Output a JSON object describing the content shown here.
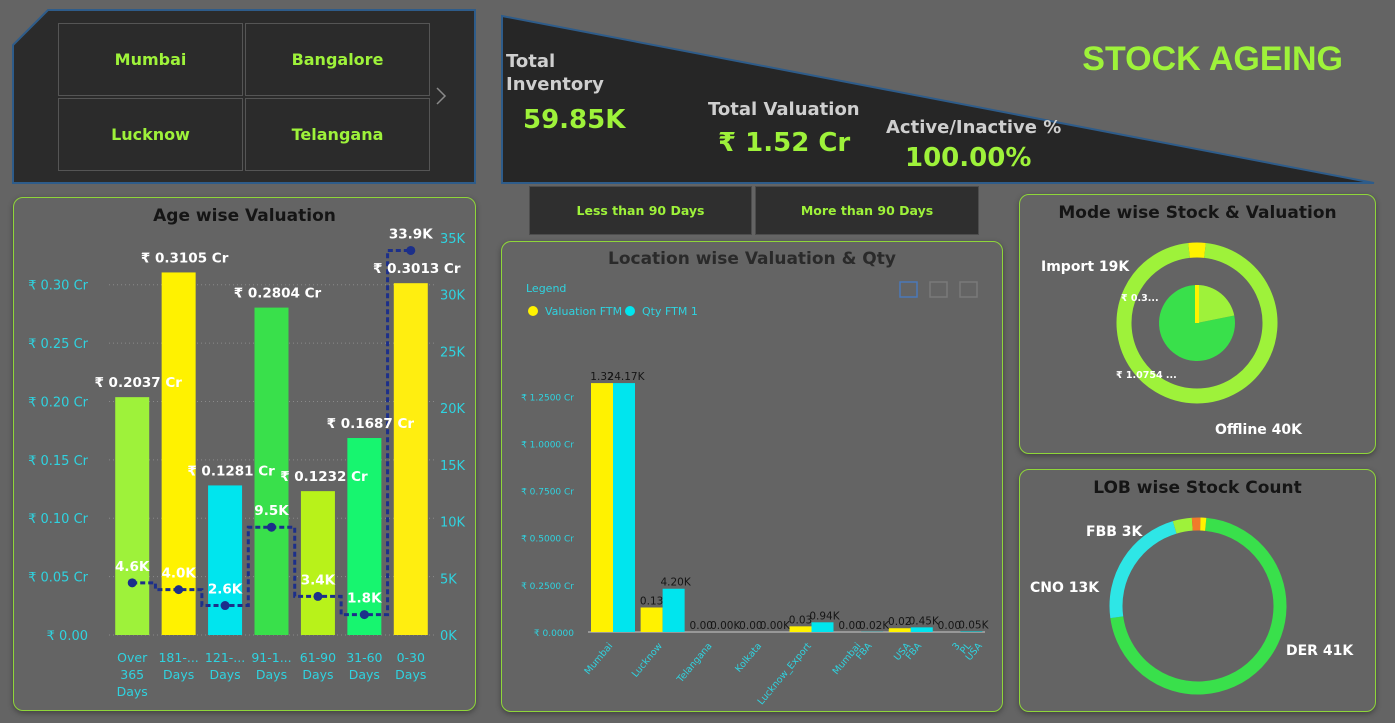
{
  "header": {
    "title": "STOCK AGEING",
    "colors": {
      "accent": "#9ef23a",
      "dark_panel": "#2b2b2b",
      "panel_border": "#8fd63a",
      "background": "#646464"
    }
  },
  "slicer": {
    "cities": [
      "Mumbai",
      "Bangalore",
      "Lucknow",
      "Telangana"
    ],
    "next_icon": "chevron-right-icon"
  },
  "kpis": {
    "total_inventory_label": "Total Inventory",
    "total_inventory_value": "59.85K",
    "total_valuation_label": "Total Valuation",
    "total_valuation_value": "₹ 1.52 Cr",
    "active_label": "Active/Inactive %",
    "active_value": "100.00%"
  },
  "filters": {
    "less_90": "Less than 90 Days",
    "more_90": "More than 90 Days"
  },
  "age_chart": {
    "title": "Age wise Valuation",
    "chart_data": {
      "type": "bar",
      "categories": [
        [
          "Over",
          "365",
          "Days"
        ],
        [
          "181-...",
          "Days"
        ],
        [
          "121-...",
          "Days"
        ],
        [
          "91-1...",
          "Days"
        ],
        [
          "61-90",
          "Days"
        ],
        [
          "31-60",
          "Days"
        ],
        [
          "0-30",
          "Days"
        ]
      ],
      "series": [
        {
          "values": [
            0.2037,
            0.3105,
            0.1281,
            0.2804,
            0.1232,
            0.1687,
            0.3013
          ],
          "labels": [
            "₹ 0.2037 Cr",
            "₹ 0.3105 Cr",
            "₹ 0.1281 Cr",
            "₹ 0.2804 Cr",
            "₹ 0.1232 Cr",
            "₹ 0.1687 Cr",
            "₹ 0.3013 Cr"
          ],
          "colors": [
            "#9ef23a",
            "#fff200",
            "#00e5ee",
            "#39e04b",
            "#b8f21a",
            "#17f56f",
            "#ffee10"
          ]
        },
        {
          "type": "line",
          "values": [
            4.6,
            4.0,
            2.6,
            9.5,
            3.4,
            1.8,
            33.9
          ],
          "labels": [
            "4.6K",
            "4.0K",
            "2.6K",
            "9.5K",
            "3.4K",
            "1.8K",
            "33.9K"
          ]
        }
      ],
      "ylim_left": [
        0,
        0.34
      ],
      "y_ticks_left": [
        "₹ 0.00",
        "₹ 0.05 Cr",
        "₹ 0.10 Cr",
        "₹ 0.15 Cr",
        "₹ 0.20 Cr",
        "₹ 0.25 Cr",
        "₹ 0.30 Cr"
      ],
      "ylim_right": [
        0,
        35
      ],
      "y_ticks_right": [
        "0K",
        "5K",
        "10K",
        "15K",
        "20K",
        "25K",
        "30K",
        "35K"
      ],
      "grid": true
    }
  },
  "location_chart": {
    "title": "Location wise Valuation & Qty",
    "legend_title": "Legend",
    "chart_data": {
      "type": "bar",
      "categories": [
        "Mumbai",
        "Lucknow",
        "Telangana",
        "Kolkata",
        "Lucknow_Export",
        "Mumbai FBA",
        "USA FBA",
        "3 PL USA"
      ],
      "series": [
        {
          "name": "Valuation FTM",
          "color": "#fff200",
          "values": [
            1.32,
            0.13,
            0.0,
            0.0,
            0.03,
            0.0,
            0.02,
            0.0
          ],
          "labels": [
            "1.32",
            "0.13",
            "0.00",
            "0.00",
            "0.03",
            "0.00",
            "0.02",
            "0.00"
          ]
        },
        {
          "name": "Qty FTM 1",
          "color": "#00e5ee",
          "values": [
            24.17,
            4.2,
            0.0,
            0.0,
            0.94,
            0.02,
            0.45,
            0.05
          ],
          "labels": [
            "24.17K",
            "4.20K",
            "0.00K",
            "0.00K",
            "0.94K",
            "0.02K",
            "0.45K",
            "0.05K"
          ]
        }
      ],
      "y_ticks": [
        "₹ 0.0000",
        "₹ 0.2500 Cr",
        "₹ 0.5000 Cr",
        "₹ 0.7500 Cr",
        "₹ 1.0000 Cr",
        "₹ 1.2500 Cr"
      ],
      "ylim": [
        0,
        1.4
      ]
    }
  },
  "mode_chart": {
    "title": "Mode wise Stock & Valuation",
    "chart_data": {
      "type": "pie",
      "categories": [
        "Import",
        "Offline"
      ],
      "outer_values": [
        19,
        40
      ],
      "outer_labels": [
        "Import 19K",
        "Offline 40K"
      ],
      "inner_values": [
        0.3,
        1.0754
      ],
      "inner_labels": [
        "₹ 0.3...",
        "₹ 1.0754 ..."
      ],
      "colors": [
        "#fff200",
        "#9ef23a",
        "#39e04b"
      ]
    }
  },
  "lob_chart": {
    "title": "LOB wise Stock Count",
    "chart_data": {
      "type": "pie",
      "categories": [
        "DER",
        "CNO",
        "FBB"
      ],
      "values": [
        41,
        13,
        3
      ],
      "labels": [
        "DER 41K",
        "CNO 13K",
        "FBB 3K"
      ],
      "colors": [
        "#39e04b",
        "#2ee6e6",
        "#9ef23a",
        "#f07a2a",
        "#fff200"
      ]
    }
  }
}
